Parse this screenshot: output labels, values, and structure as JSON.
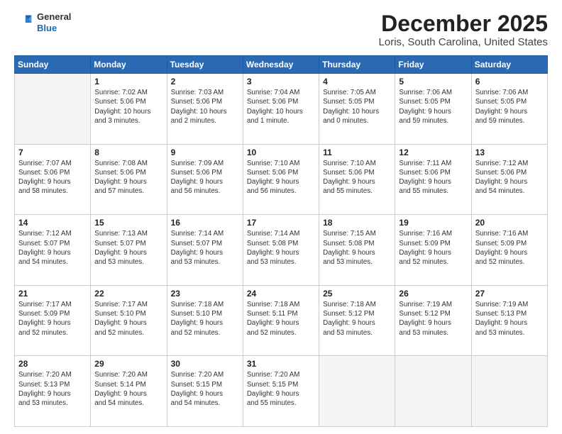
{
  "logo": {
    "general": "General",
    "blue": "Blue"
  },
  "header": {
    "month": "December 2025",
    "location": "Loris, South Carolina, United States"
  },
  "weekdays": [
    "Sunday",
    "Monday",
    "Tuesday",
    "Wednesday",
    "Thursday",
    "Friday",
    "Saturday"
  ],
  "weeks": [
    [
      {
        "day": "",
        "info": ""
      },
      {
        "day": "1",
        "info": "Sunrise: 7:02 AM\nSunset: 5:06 PM\nDaylight: 10 hours\nand 3 minutes."
      },
      {
        "day": "2",
        "info": "Sunrise: 7:03 AM\nSunset: 5:06 PM\nDaylight: 10 hours\nand 2 minutes."
      },
      {
        "day": "3",
        "info": "Sunrise: 7:04 AM\nSunset: 5:06 PM\nDaylight: 10 hours\nand 1 minute."
      },
      {
        "day": "4",
        "info": "Sunrise: 7:05 AM\nSunset: 5:05 PM\nDaylight: 10 hours\nand 0 minutes."
      },
      {
        "day": "5",
        "info": "Sunrise: 7:06 AM\nSunset: 5:05 PM\nDaylight: 9 hours\nand 59 minutes."
      },
      {
        "day": "6",
        "info": "Sunrise: 7:06 AM\nSunset: 5:05 PM\nDaylight: 9 hours\nand 59 minutes."
      }
    ],
    [
      {
        "day": "7",
        "info": "Sunrise: 7:07 AM\nSunset: 5:06 PM\nDaylight: 9 hours\nand 58 minutes."
      },
      {
        "day": "8",
        "info": "Sunrise: 7:08 AM\nSunset: 5:06 PM\nDaylight: 9 hours\nand 57 minutes."
      },
      {
        "day": "9",
        "info": "Sunrise: 7:09 AM\nSunset: 5:06 PM\nDaylight: 9 hours\nand 56 minutes."
      },
      {
        "day": "10",
        "info": "Sunrise: 7:10 AM\nSunset: 5:06 PM\nDaylight: 9 hours\nand 56 minutes."
      },
      {
        "day": "11",
        "info": "Sunrise: 7:10 AM\nSunset: 5:06 PM\nDaylight: 9 hours\nand 55 minutes."
      },
      {
        "day": "12",
        "info": "Sunrise: 7:11 AM\nSunset: 5:06 PM\nDaylight: 9 hours\nand 55 minutes."
      },
      {
        "day": "13",
        "info": "Sunrise: 7:12 AM\nSunset: 5:06 PM\nDaylight: 9 hours\nand 54 minutes."
      }
    ],
    [
      {
        "day": "14",
        "info": "Sunrise: 7:12 AM\nSunset: 5:07 PM\nDaylight: 9 hours\nand 54 minutes."
      },
      {
        "day": "15",
        "info": "Sunrise: 7:13 AM\nSunset: 5:07 PM\nDaylight: 9 hours\nand 53 minutes."
      },
      {
        "day": "16",
        "info": "Sunrise: 7:14 AM\nSunset: 5:07 PM\nDaylight: 9 hours\nand 53 minutes."
      },
      {
        "day": "17",
        "info": "Sunrise: 7:14 AM\nSunset: 5:08 PM\nDaylight: 9 hours\nand 53 minutes."
      },
      {
        "day": "18",
        "info": "Sunrise: 7:15 AM\nSunset: 5:08 PM\nDaylight: 9 hours\nand 53 minutes."
      },
      {
        "day": "19",
        "info": "Sunrise: 7:16 AM\nSunset: 5:09 PM\nDaylight: 9 hours\nand 52 minutes."
      },
      {
        "day": "20",
        "info": "Sunrise: 7:16 AM\nSunset: 5:09 PM\nDaylight: 9 hours\nand 52 minutes."
      }
    ],
    [
      {
        "day": "21",
        "info": "Sunrise: 7:17 AM\nSunset: 5:09 PM\nDaylight: 9 hours\nand 52 minutes."
      },
      {
        "day": "22",
        "info": "Sunrise: 7:17 AM\nSunset: 5:10 PM\nDaylight: 9 hours\nand 52 minutes."
      },
      {
        "day": "23",
        "info": "Sunrise: 7:18 AM\nSunset: 5:10 PM\nDaylight: 9 hours\nand 52 minutes."
      },
      {
        "day": "24",
        "info": "Sunrise: 7:18 AM\nSunset: 5:11 PM\nDaylight: 9 hours\nand 52 minutes."
      },
      {
        "day": "25",
        "info": "Sunrise: 7:18 AM\nSunset: 5:12 PM\nDaylight: 9 hours\nand 53 minutes."
      },
      {
        "day": "26",
        "info": "Sunrise: 7:19 AM\nSunset: 5:12 PM\nDaylight: 9 hours\nand 53 minutes."
      },
      {
        "day": "27",
        "info": "Sunrise: 7:19 AM\nSunset: 5:13 PM\nDaylight: 9 hours\nand 53 minutes."
      }
    ],
    [
      {
        "day": "28",
        "info": "Sunrise: 7:20 AM\nSunset: 5:13 PM\nDaylight: 9 hours\nand 53 minutes."
      },
      {
        "day": "29",
        "info": "Sunrise: 7:20 AM\nSunset: 5:14 PM\nDaylight: 9 hours\nand 54 minutes."
      },
      {
        "day": "30",
        "info": "Sunrise: 7:20 AM\nSunset: 5:15 PM\nDaylight: 9 hours\nand 54 minutes."
      },
      {
        "day": "31",
        "info": "Sunrise: 7:20 AM\nSunset: 5:15 PM\nDaylight: 9 hours\nand 55 minutes."
      },
      {
        "day": "",
        "info": ""
      },
      {
        "day": "",
        "info": ""
      },
      {
        "day": "",
        "info": ""
      }
    ]
  ]
}
